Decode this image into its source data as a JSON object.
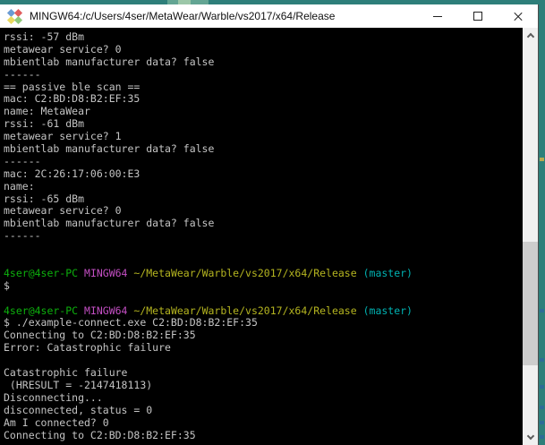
{
  "window": {
    "title": "MINGW64:/c/Users/4ser/MetaWear/Warble/vs2017/x64/Release",
    "controls": {
      "minimize": "minimize",
      "maximize": "maximize",
      "close": "close"
    }
  },
  "colors": {
    "fg": "#c4c4c4",
    "green": "#0db00d",
    "magenta": "#c44fc4",
    "yellow": "#b5b520",
    "cyan": "#00b2b2",
    "term-bg": "#000000",
    "titlebar-bg": "#ffffff",
    "title-fg": "#111111",
    "desktop": "#2e7f7a",
    "sb-track": "#f0f0f0",
    "sb-thumb": "#cdcdcd",
    "sb-arrow": "#5a5a5a"
  },
  "terminal": {
    "lines": [
      {
        "seg": [
          {
            "c": "fg",
            "t": "rssi: -57 dBm"
          }
        ]
      },
      {
        "seg": [
          {
            "c": "fg",
            "t": "metawear service? 0"
          }
        ]
      },
      {
        "seg": [
          {
            "c": "fg",
            "t": "mbientlab manufacturer data? false"
          }
        ]
      },
      {
        "seg": [
          {
            "c": "fg",
            "t": "------"
          }
        ]
      },
      {
        "seg": [
          {
            "c": "fg",
            "t": "== passive ble scan =="
          }
        ]
      },
      {
        "seg": [
          {
            "c": "fg",
            "t": "mac: C2:BD:D8:B2:EF:35"
          }
        ]
      },
      {
        "seg": [
          {
            "c": "fg",
            "t": "name: MetaWear"
          }
        ]
      },
      {
        "seg": [
          {
            "c": "fg",
            "t": "rssi: -61 dBm"
          }
        ]
      },
      {
        "seg": [
          {
            "c": "fg",
            "t": "metawear service? 1"
          }
        ]
      },
      {
        "seg": [
          {
            "c": "fg",
            "t": "mbientlab manufacturer data? false"
          }
        ]
      },
      {
        "seg": [
          {
            "c": "fg",
            "t": "------"
          }
        ]
      },
      {
        "seg": [
          {
            "c": "fg",
            "t": "mac: 2C:26:17:06:00:E3"
          }
        ]
      },
      {
        "seg": [
          {
            "c": "fg",
            "t": "name:"
          }
        ]
      },
      {
        "seg": [
          {
            "c": "fg",
            "t": "rssi: -65 dBm"
          }
        ]
      },
      {
        "seg": [
          {
            "c": "fg",
            "t": "metawear service? 0"
          }
        ]
      },
      {
        "seg": [
          {
            "c": "fg",
            "t": "mbientlab manufacturer data? false"
          }
        ]
      },
      {
        "seg": [
          {
            "c": "fg",
            "t": "------"
          }
        ]
      },
      {
        "seg": []
      },
      {
        "seg": []
      },
      {
        "seg": [
          {
            "c": "green",
            "t": "4ser@4ser-PC "
          },
          {
            "c": "magenta",
            "t": "MINGW64 "
          },
          {
            "c": "yellow",
            "t": "~/MetaWear/Warble/vs2017/x64/Release "
          },
          {
            "c": "cyan",
            "t": "(master)"
          }
        ]
      },
      {
        "seg": [
          {
            "c": "fg",
            "t": "$"
          }
        ]
      },
      {
        "seg": []
      },
      {
        "seg": [
          {
            "c": "green",
            "t": "4ser@4ser-PC "
          },
          {
            "c": "magenta",
            "t": "MINGW64 "
          },
          {
            "c": "yellow",
            "t": "~/MetaWear/Warble/vs2017/x64/Release "
          },
          {
            "c": "cyan",
            "t": "(master)"
          }
        ]
      },
      {
        "seg": [
          {
            "c": "fg",
            "t": "$ ./example-connect.exe C2:BD:D8:B2:EF:35"
          }
        ]
      },
      {
        "seg": [
          {
            "c": "fg",
            "t": "Connecting to C2:BD:D8:B2:EF:35"
          }
        ]
      },
      {
        "seg": [
          {
            "c": "fg",
            "t": "Error: Catastrophic failure"
          }
        ]
      },
      {
        "seg": []
      },
      {
        "seg": [
          {
            "c": "fg",
            "t": "Catastrophic failure"
          }
        ]
      },
      {
        "seg": [
          {
            "c": "fg",
            "t": " (HRESULT = -2147418113)"
          }
        ]
      },
      {
        "seg": [
          {
            "c": "fg",
            "t": "Disconnecting..."
          }
        ]
      },
      {
        "seg": [
          {
            "c": "fg",
            "t": "disconnected, status = 0"
          }
        ]
      },
      {
        "seg": [
          {
            "c": "fg",
            "t": "Am I connected? 0"
          }
        ]
      },
      {
        "seg": [
          {
            "c": "fg",
            "t": "Connecting to C2:BD:D8:B2:EF:35"
          }
        ]
      }
    ]
  }
}
